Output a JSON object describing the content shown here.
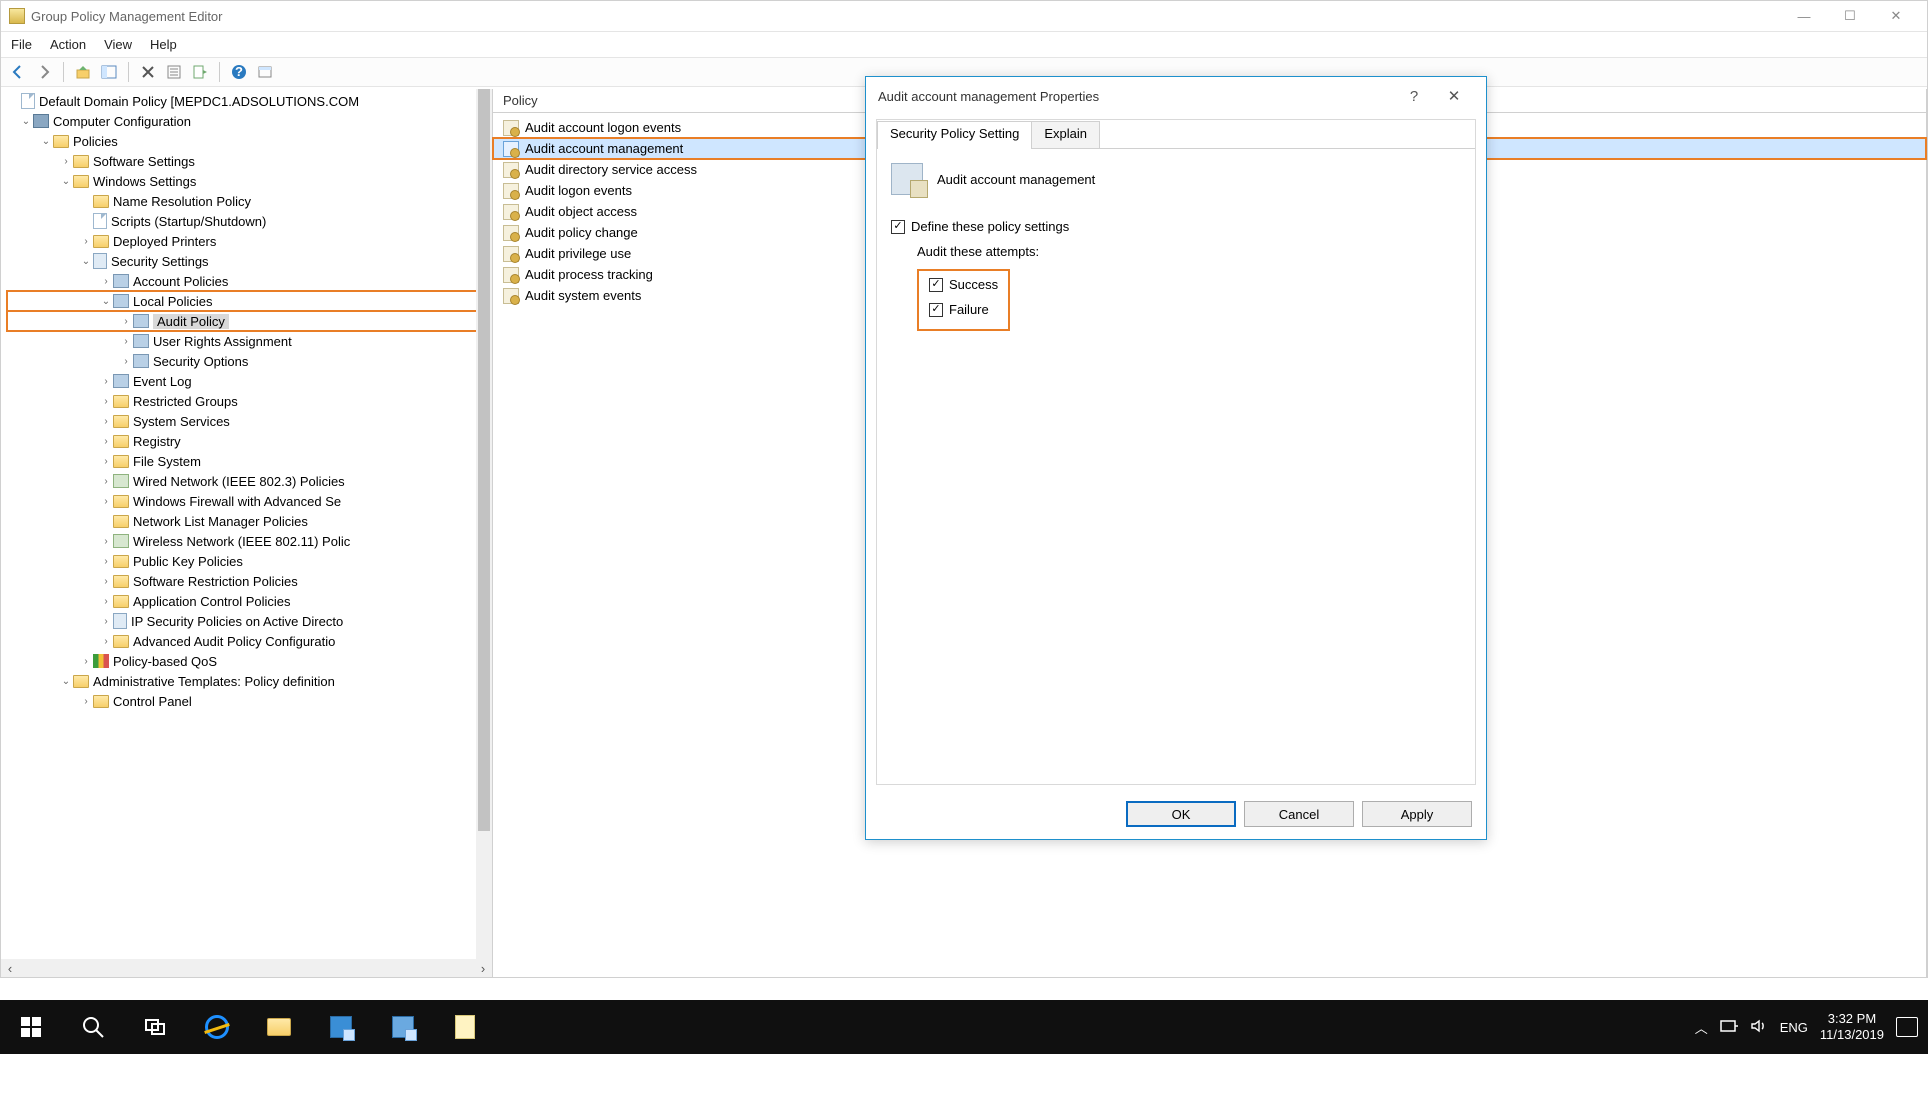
{
  "window": {
    "title": "Group Policy Management Editor",
    "menus": [
      "File",
      "Action",
      "View",
      "Help"
    ]
  },
  "tree": {
    "root": "Default Domain Policy [MEPDC1.ADSOLUTIONS.COM",
    "computer_config": "Computer Configuration",
    "policies": "Policies",
    "software": "Software Settings",
    "windows": "Windows Settings",
    "nrp": "Name Resolution Policy",
    "scripts": "Scripts (Startup/Shutdown)",
    "printers": "Deployed Printers",
    "security": "Security Settings",
    "account": "Account Policies",
    "local": "Local Policies",
    "audit": "Audit Policy",
    "ura": "User Rights Assignment",
    "secopt": "Security Options",
    "eventlog": "Event Log",
    "restricted": "Restricted Groups",
    "sysserv": "System Services",
    "registry": "Registry",
    "filesys": "File System",
    "wired": "Wired Network (IEEE 802.3) Policies",
    "firewall": "Windows Firewall with Advanced Se",
    "netlist": "Network List Manager Policies",
    "wireless": "Wireless Network (IEEE 802.11) Polic",
    "pki": "Public Key Policies",
    "srp": "Software Restriction Policies",
    "acp": "Application Control Policies",
    "ipsec": "IP Security Policies on Active Directo",
    "advaudit": "Advanced Audit Policy Configuratio",
    "qos": "Policy-based QoS",
    "admin": "Administrative Templates: Policy definition",
    "cpanel": "Control Panel"
  },
  "list": {
    "header": "Policy",
    "items": [
      "Audit account logon events",
      "Audit account management",
      "Audit directory service access",
      "Audit logon events",
      "Audit object access",
      "Audit policy change",
      "Audit privilege use",
      "Audit process tracking",
      "Audit system events"
    ]
  },
  "dialog": {
    "title": "Audit account management Properties",
    "tab1": "Security Policy Setting",
    "tab2": "Explain",
    "policy_name": "Audit account management",
    "define": "Define these policy settings",
    "attempts_label": "Audit these attempts:",
    "success": "Success",
    "failure": "Failure",
    "ok": "OK",
    "cancel": "Cancel",
    "apply": "Apply"
  },
  "taskbar": {
    "lang": "ENG",
    "time": "3:32 PM",
    "date": "11/13/2019"
  }
}
